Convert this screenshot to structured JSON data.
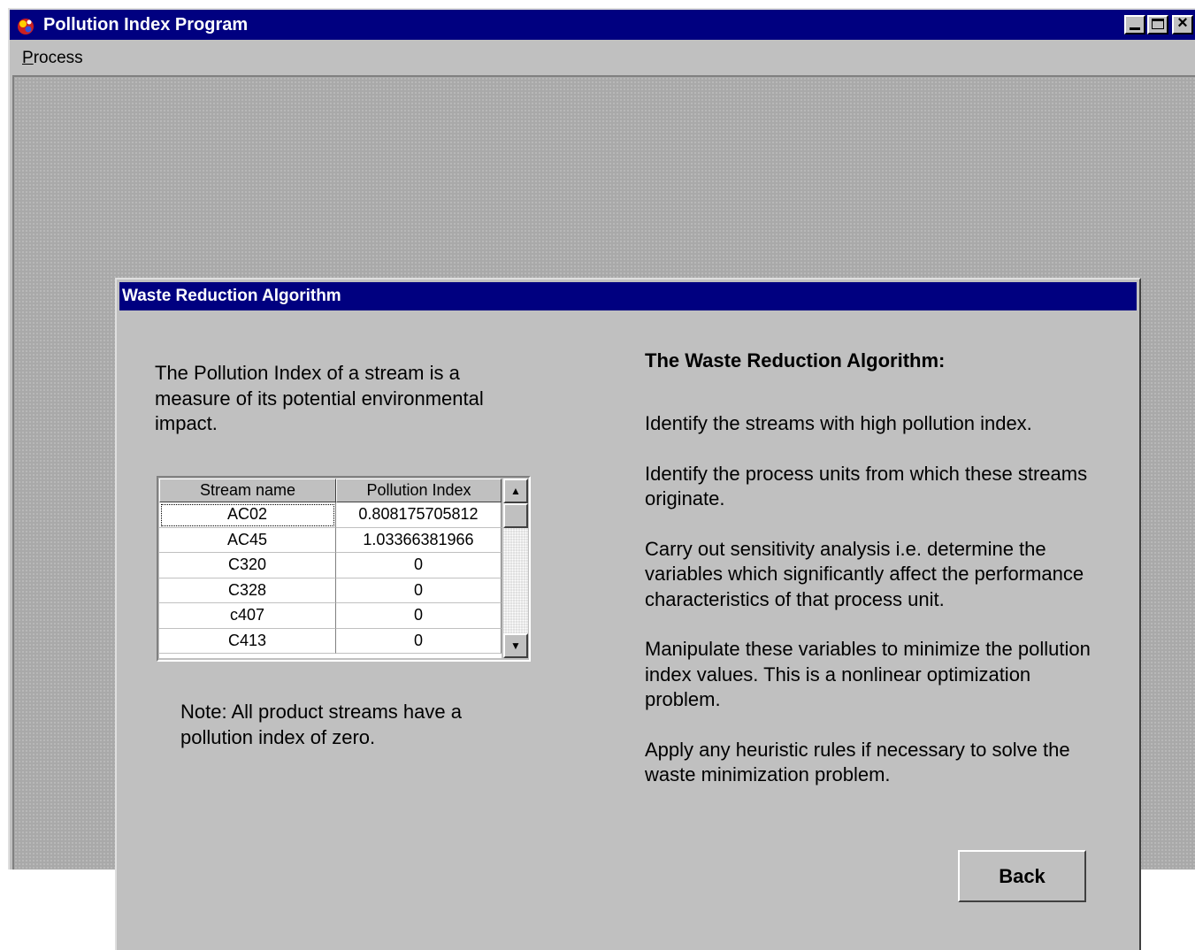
{
  "window": {
    "title": "Pollution Index Program",
    "icon": "app-icon"
  },
  "menu": {
    "process_mnemonic": "P",
    "process_rest": "rocess"
  },
  "dialog": {
    "title": "Waste Reduction Algorithm",
    "intro": "The Pollution Index of a stream is a measure of its  potential environmental impact.",
    "grid": {
      "headers": [
        "Stream name",
        "Pollution Index"
      ],
      "rows": [
        {
          "name": "AC02",
          "index": "0.808175705812"
        },
        {
          "name": "AC45",
          "index": "1.03366381966"
        },
        {
          "name": "C320",
          "index": "0"
        },
        {
          "name": "C328",
          "index": "0"
        },
        {
          "name": "c407",
          "index": "0"
        },
        {
          "name": "C413",
          "index": "0"
        }
      ]
    },
    "note": "Note: All product streams have a pollution index of zero.",
    "right_heading": "The Waste Reduction Algorithm:",
    "steps": [
      "Identify the streams with high pollution index.",
      "Identify the process units from which these streams originate.",
      "Carry out sensitivity analysis i.e. determine the variables which significantly affect the performance characteristics of that process unit.",
      "Manipulate these variables to minimize the pollution index values. This is a nonlinear optimization problem.",
      "Apply any heuristic rules if necessary to solve the waste minimization problem."
    ],
    "back_label": "Back"
  },
  "colors": {
    "titlebar": "#000080",
    "face": "#c0c0c0"
  }
}
